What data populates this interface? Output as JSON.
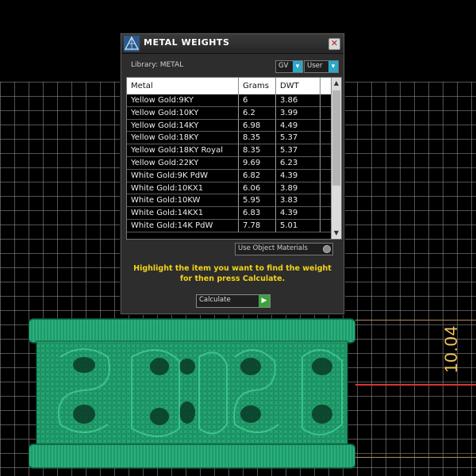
{
  "dialog": {
    "title": "METAL WEIGHTS",
    "close_label": "✕",
    "library_label": "Library: METAL",
    "gv_select": {
      "value": "GV"
    },
    "user_select": {
      "value": "User"
    },
    "table": {
      "headers": [
        "Metal",
        "Grams",
        "DWT"
      ],
      "rows": [
        [
          "Yellow Gold:9KY",
          "6",
          "3.86"
        ],
        [
          "Yellow Gold:10KY",
          "6.2",
          "3.99"
        ],
        [
          "Yellow Gold:14KY",
          "6.98",
          "4.49"
        ],
        [
          "Yellow Gold:18KY",
          "8.35",
          "5.37"
        ],
        [
          "Yellow Gold:18KY Royal",
          "8.35",
          "5.37"
        ],
        [
          "Yellow Gold:22KY",
          "9.69",
          "6.23"
        ],
        [
          "White Gold:9K PdW",
          "6.82",
          "4.39"
        ],
        [
          "White Gold:10KX1",
          "6.06",
          "3.89"
        ],
        [
          "White Gold:10KW",
          "5.95",
          "3.83"
        ],
        [
          "White Gold:14KX1",
          "6.83",
          "4.39"
        ],
        [
          "White Gold:14K PdW",
          "7.78",
          "5.01"
        ]
      ]
    },
    "use_object_materials": "Use Object Materials",
    "instruction": "Highlight the item you want to find the weight for then press Calculate.",
    "calculate_label": "Calculate"
  },
  "viewport": {
    "dimension_value": "10.04",
    "colors": {
      "ring": "#1f9a6a",
      "dimension_line": "#dd3333",
      "dimension_text": "#f2c45a",
      "instruction_text": "#f1d419",
      "accent": "#2aa7c9"
    }
  }
}
